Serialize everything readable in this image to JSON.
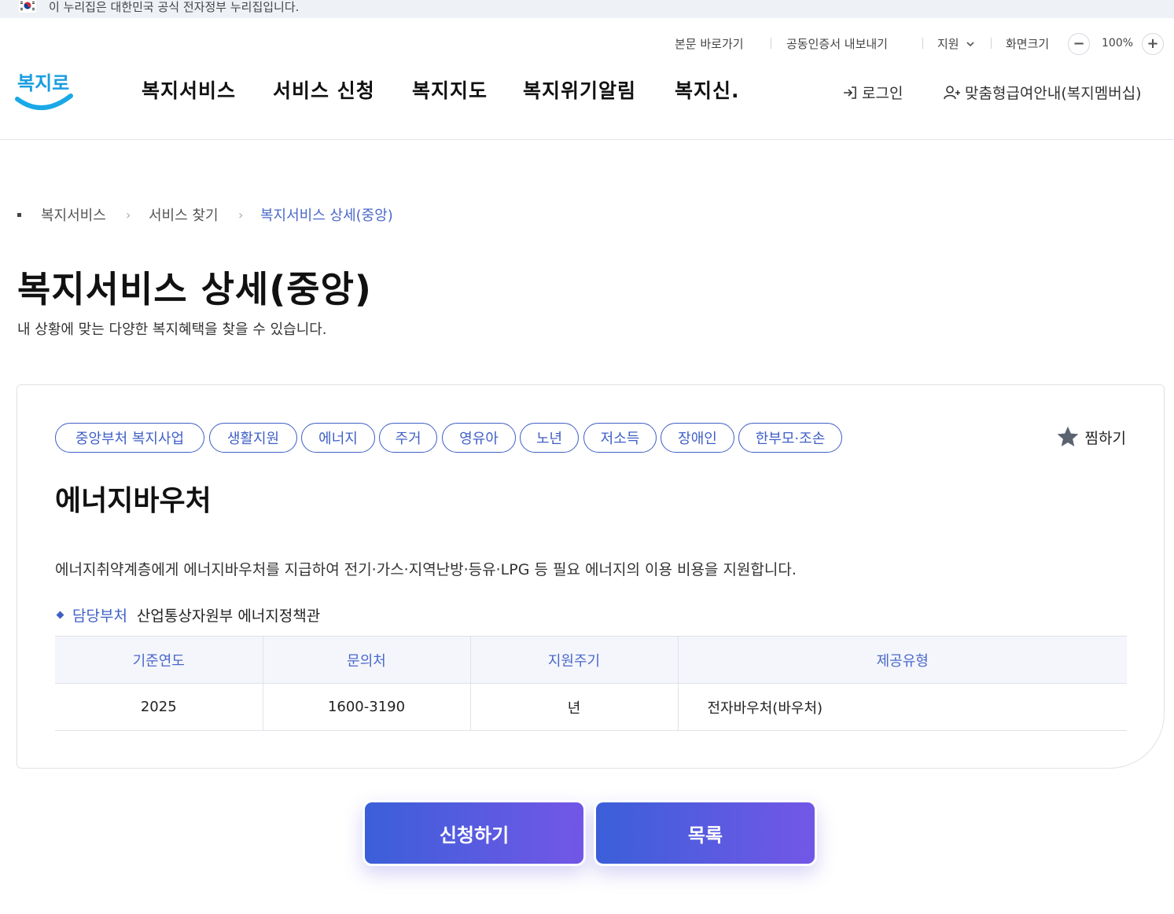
{
  "gov_banner": {
    "text": "이 누리집은 대한민국 공식 전자정부 누리집입니다."
  },
  "utility": {
    "skip_to_content": "본문 바로가기",
    "cert_export": "공동인증서 내보내기",
    "support": "지원",
    "screen_size_label": "화면크기",
    "zoom": "100%",
    "minus": "−",
    "plus": "+"
  },
  "logo": {
    "text": "복지로"
  },
  "gnb": {
    "items": [
      "복지서비스",
      "서비스 신청",
      "복지지도",
      "복지위기알림",
      "복지신."
    ]
  },
  "header_right": {
    "login": "로그인",
    "membership": "맞춤형급여안내(복지멤버십)"
  },
  "breadcrumb": {
    "items": [
      "복지서비스",
      "서비스 찾기",
      "복지서비스 상세(중앙)"
    ]
  },
  "page": {
    "title": "복지서비스 상세(중앙)",
    "description": "내 상황에 맞는 다양한 복지혜택을 찾을 수 있습니다."
  },
  "service": {
    "tags": [
      "중앙부처 복지사업",
      "생활지원",
      "에너지",
      "주거",
      "영유아",
      "노년",
      "저소득",
      "장애인",
      "한부모·조손"
    ],
    "favorite": "찜하기",
    "title": "에너지바우처",
    "description": "에너지취약계층에게 에너지바우처를 지급하여 전기·가스·지역난방·등유·LPG 등 필요 에너지의 이용 비용을 지원합니다.",
    "dept_label": "담당부처",
    "dept_value": "산업통상자원부 에너지정책관",
    "table": {
      "headers": [
        "기준연도",
        "문의처",
        "지원주기",
        "제공유형"
      ],
      "row": [
        "2025",
        "1600-3190",
        "년",
        "전자바우처(바우처)"
      ]
    }
  },
  "buttons": {
    "apply": "신청하기",
    "list": "목록"
  },
  "colors": {
    "accent": "#3f5fc6",
    "button_start": "#3b5fd9",
    "button_end": "#7357e6"
  },
  "icons": [
    "korea-flag-icon",
    "chevron-down-icon",
    "minus-icon",
    "plus-icon",
    "login-icon",
    "user-add-icon",
    "star-icon",
    "chevron-right-icon"
  ]
}
